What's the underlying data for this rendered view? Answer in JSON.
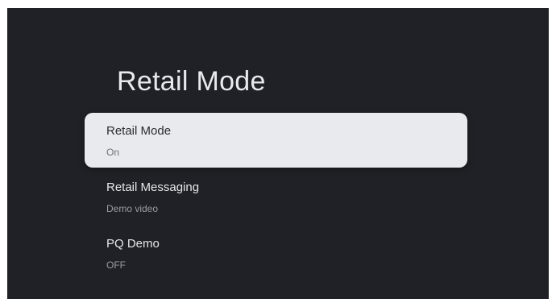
{
  "page": {
    "title": "Retail Mode"
  },
  "menu": {
    "items": [
      {
        "label": "Retail Mode",
        "value": "On",
        "selected": true
      },
      {
        "label": "Retail Messaging",
        "value": "Demo video",
        "selected": false
      },
      {
        "label": "PQ Demo",
        "value": "OFF",
        "selected": false
      }
    ]
  },
  "colors": {
    "background": "#202126",
    "selected_item_bg": "#e8eaee",
    "title_text": "#e9eaed",
    "secondary_text": "#9a9ca1"
  }
}
